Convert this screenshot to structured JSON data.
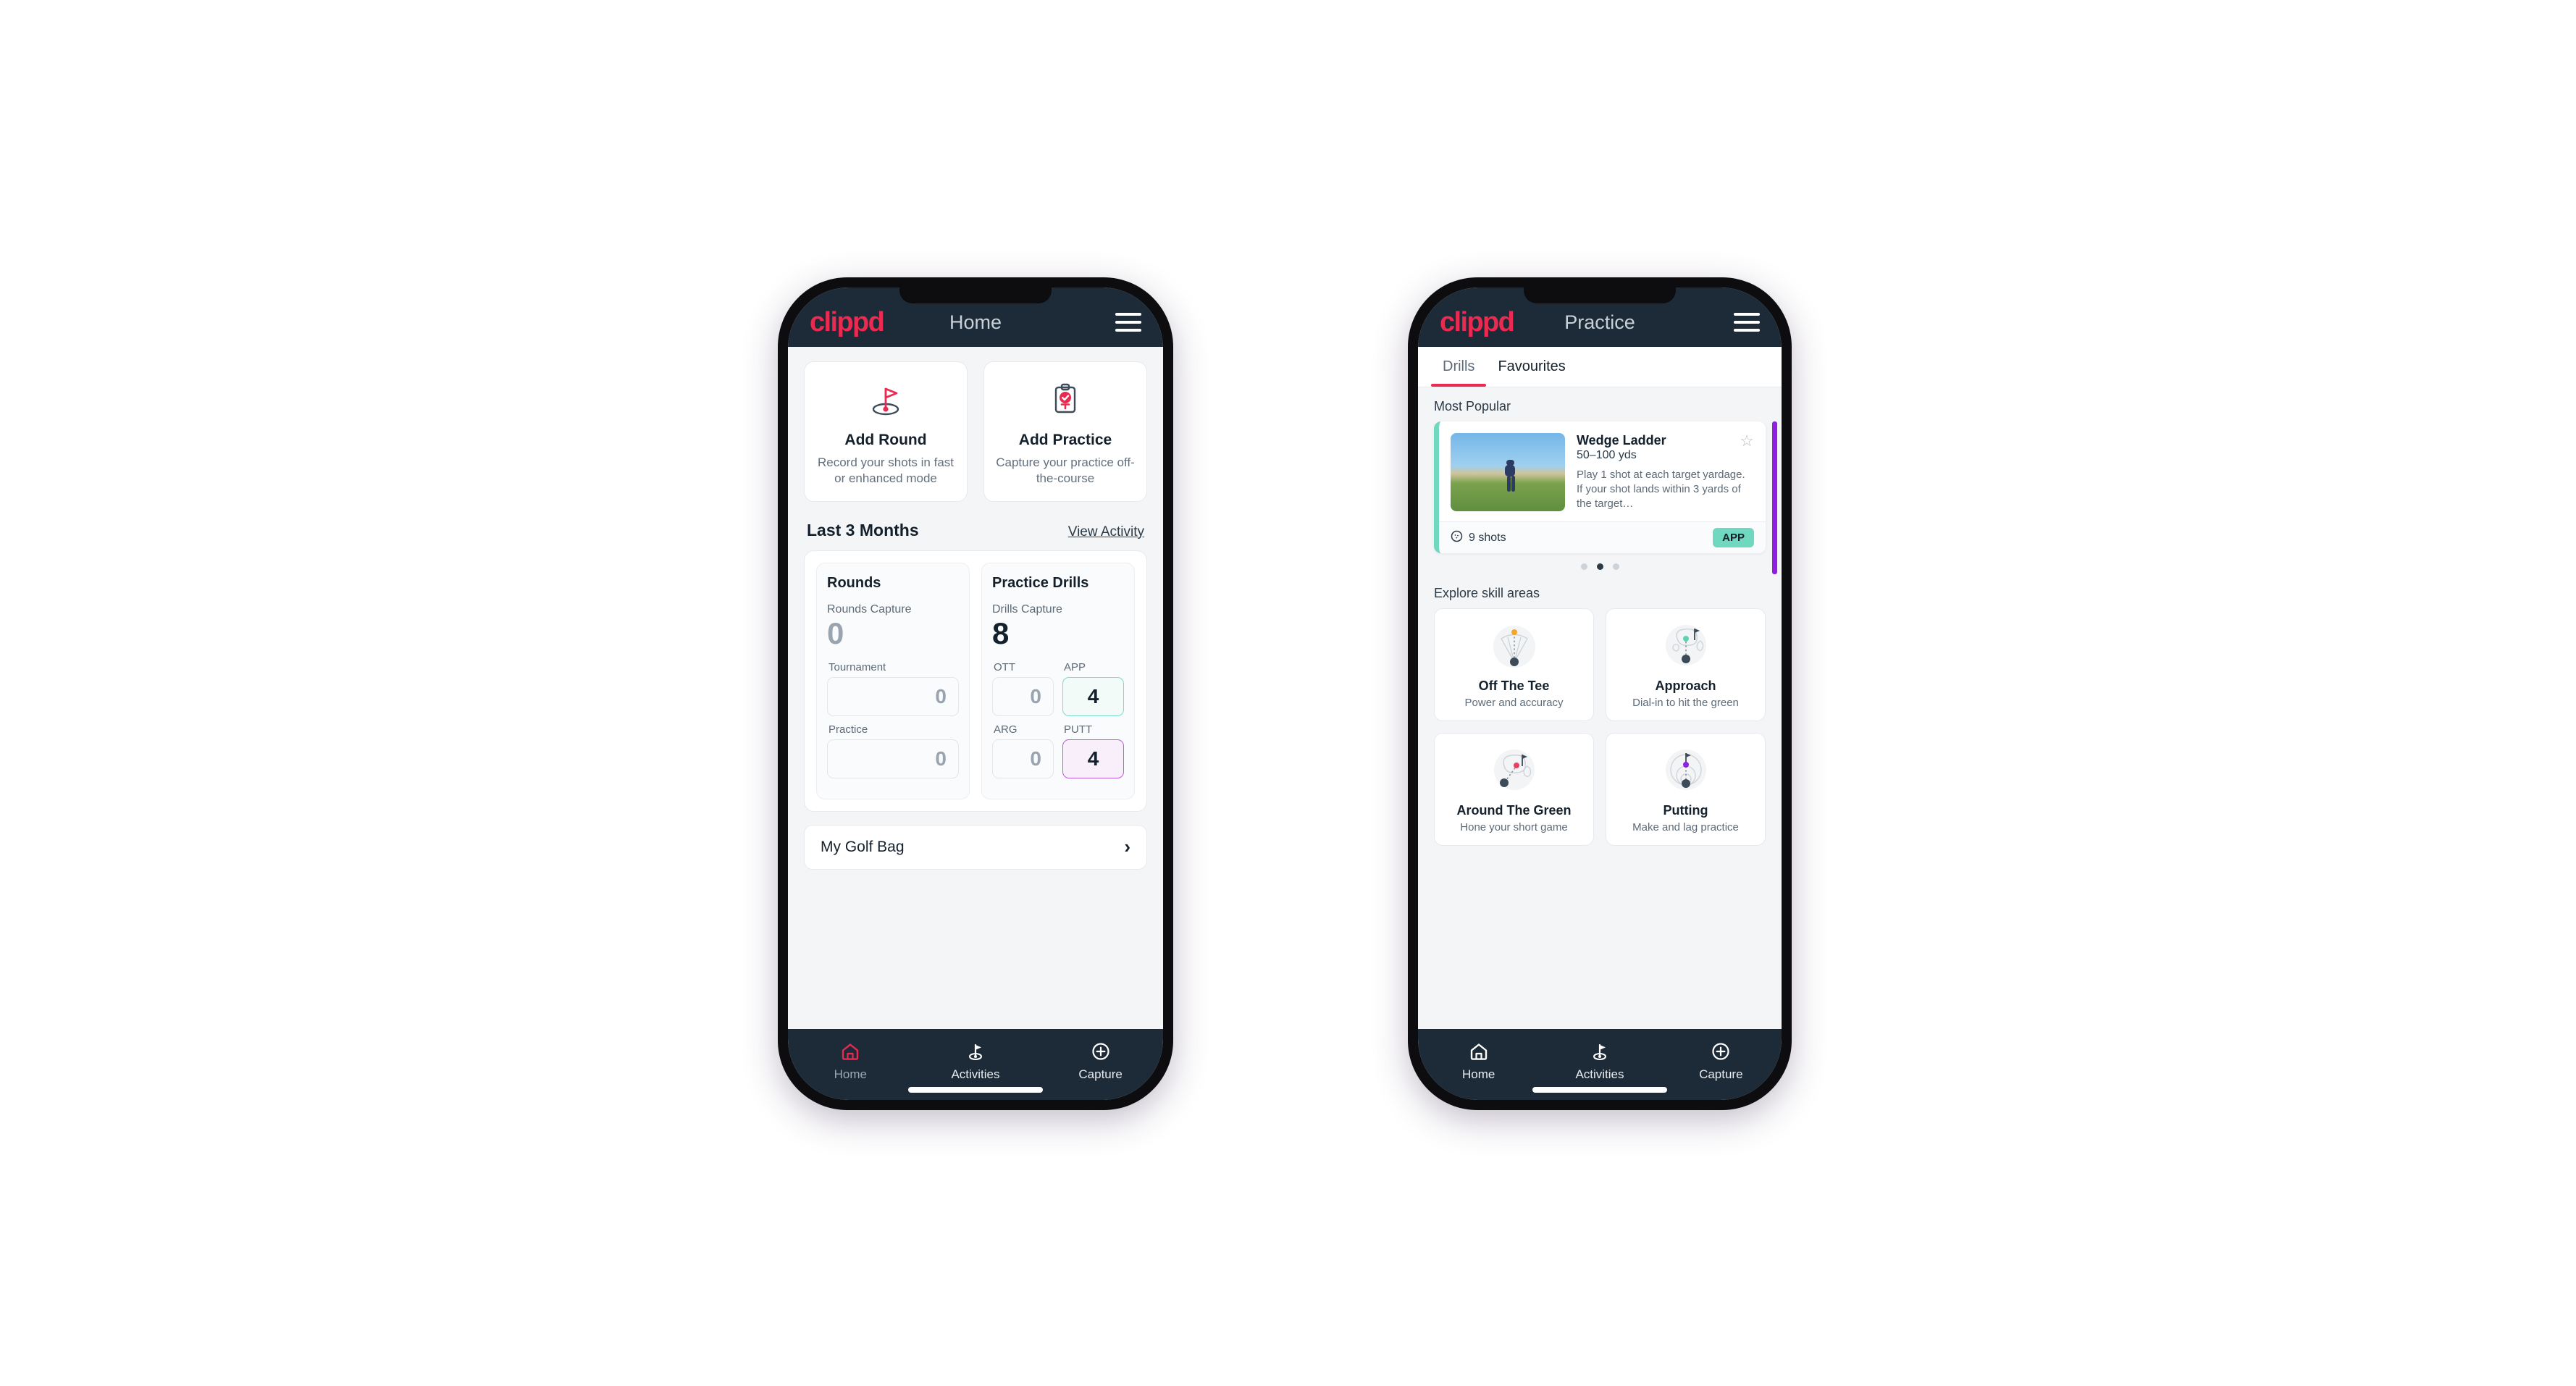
{
  "home": {
    "appbar": {
      "logo": "clippd",
      "title": "Home",
      "menu_icon": "hamburger-menu-icon"
    },
    "actions": [
      {
        "icon": "golf-flag-hole-icon",
        "title": "Add Round",
        "subtitle": "Record your shots in fast or enhanced mode"
      },
      {
        "icon": "clipboard-check-icon",
        "title": "Add Practice",
        "subtitle": "Capture your practice off-the-course"
      }
    ],
    "section": {
      "title": "Last 3 Months",
      "link": "View Activity"
    },
    "rounds": {
      "heading": "Rounds",
      "capture_label": "Rounds Capture",
      "capture_value": "0",
      "fields": [
        {
          "label": "Tournament",
          "value": "0"
        },
        {
          "label": "Practice",
          "value": "0"
        }
      ]
    },
    "drills": {
      "heading": "Practice Drills",
      "capture_label": "Drills Capture",
      "capture_value": "8",
      "fields": [
        {
          "label": "OTT",
          "value": "0",
          "style": "plain"
        },
        {
          "label": "APP",
          "value": "4",
          "style": "teal"
        },
        {
          "label": "ARG",
          "value": "0",
          "style": "plain"
        },
        {
          "label": "PUTT",
          "value": "4",
          "style": "purple"
        }
      ]
    },
    "golf_bag": {
      "label": "My Golf Bag",
      "chevron": "chevron-right-icon"
    },
    "nav": [
      {
        "icon": "home-icon",
        "label": "Home",
        "active": true
      },
      {
        "icon": "golf-flag-icon",
        "label": "Activities",
        "active": false
      },
      {
        "icon": "plus-circle-icon",
        "label": "Capture",
        "active": false
      }
    ]
  },
  "practice": {
    "appbar": {
      "logo": "clippd",
      "title": "Practice",
      "menu_icon": "hamburger-menu-icon"
    },
    "tabs": [
      {
        "label": "Drills",
        "active": true
      },
      {
        "label": "Favourites",
        "active": false
      }
    ],
    "most_popular_label": "Most Popular",
    "drill": {
      "title": "Wedge Ladder",
      "yardage": "50–100 yds",
      "description": "Play 1 shot at each target yardage. If your shot lands within 3 yards of the target…",
      "shots": "9 shots",
      "shots_icon": "golf-ball-icon",
      "badge": "APP",
      "favourite_icon": "star-outline-icon",
      "accent_color": "#6fd8be",
      "next_card_color": "#9020e0"
    },
    "carousel_dots": {
      "count": 3,
      "active_index": 1
    },
    "explore_label": "Explore skill areas",
    "skills": [
      {
        "icon": "tee-shot-fan-icon",
        "title": "Off The Tee",
        "subtitle": "Power and accuracy",
        "dot_color": "#f5a623"
      },
      {
        "icon": "approach-green-icon",
        "title": "Approach",
        "subtitle": "Dial-in to hit the green",
        "dot_color": "#5fd3b2"
      },
      {
        "icon": "chip-green-icon",
        "title": "Around The Green",
        "subtitle": "Hone your short game",
        "dot_color": "#ea3f63"
      },
      {
        "icon": "putting-rings-icon",
        "title": "Putting",
        "subtitle": "Make and lag practice",
        "dot_color": "#9020e0"
      }
    ],
    "nav": [
      {
        "icon": "home-icon",
        "label": "Home",
        "active": false
      },
      {
        "icon": "golf-flag-icon",
        "label": "Activities",
        "active": true
      },
      {
        "icon": "plus-circle-icon",
        "label": "Capture",
        "active": false
      }
    ]
  }
}
